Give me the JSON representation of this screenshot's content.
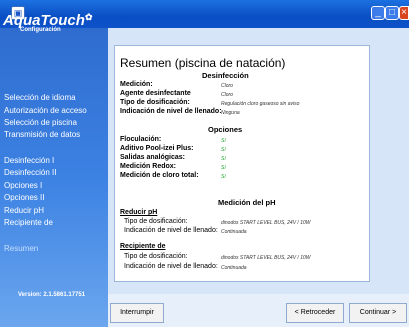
{
  "window": {
    "icon": "app-icon",
    "minimize": "_",
    "maximize": "□",
    "close": "×"
  },
  "sidebar": {
    "logo": "AquaTouch",
    "logo_symbol": "✿",
    "logo_sub": "Configuración",
    "items": [
      {
        "label": "Selección de idioma"
      },
      {
        "label": "Autorización de acceso"
      },
      {
        "label": "Selección de piscina"
      },
      {
        "label": "Transmisión de datos"
      },
      {
        "label": "Desinfección I"
      },
      {
        "label": "Desinfección II"
      },
      {
        "label": "Opciones I"
      },
      {
        "label": "Opciones II"
      },
      {
        "label": "Reducir pH"
      },
      {
        "label": "Recipiente de"
      },
      {
        "label": "Resumen"
      }
    ],
    "version": "Version: 2.1.5861.17751"
  },
  "summary": {
    "title": "Resumen (piscina de natación)",
    "desinfeccion": {
      "heading": "Desinfección",
      "rows": [
        {
          "label": "Medición:",
          "value": "Cloro"
        },
        {
          "label": "Agente desinfectante",
          "value": "Cloro"
        },
        {
          "label": "Tipo de dosificación:",
          "value": "Regulación cloro gaseoso sin aviso"
        },
        {
          "label": "Indicación de nivel de llenado:",
          "value": "Ninguna"
        }
      ]
    },
    "opciones": {
      "heading": "Opciones",
      "rows": [
        {
          "label": "Floculación:",
          "value": "Sí"
        },
        {
          "label": "Aditivo Pool-izei Plus:",
          "value": "Sí"
        },
        {
          "label": "Salidas analógicas:",
          "value": "Sí"
        },
        {
          "label": "Medición Redox:",
          "value": "Sí"
        },
        {
          "label": "Medición de cloro total:",
          "value": "Sí"
        }
      ]
    },
    "ph": {
      "heading": "Medición del pH",
      "reducir": {
        "title": "Reducir pH",
        "rows": [
          {
            "label": "Tipo de dosificación:",
            "value": "dinodos START LEVEL BUS, 24V / 10W"
          },
          {
            "label": "Indicación de nivel de llenado:",
            "value": "Continuada"
          }
        ]
      },
      "recipiente": {
        "title": "Recipiente de",
        "rows": [
          {
            "label": "Tipo de dosificación:",
            "value": "dinodos START LEVEL BUS, 24V / 10W"
          },
          {
            "label": "Indicación de nivel de llenado:",
            "value": "Continuada"
          }
        ]
      }
    }
  },
  "footer": {
    "interrupt": "Interrumpir",
    "back": "< Retroceder",
    "continue": "Continuar >"
  }
}
